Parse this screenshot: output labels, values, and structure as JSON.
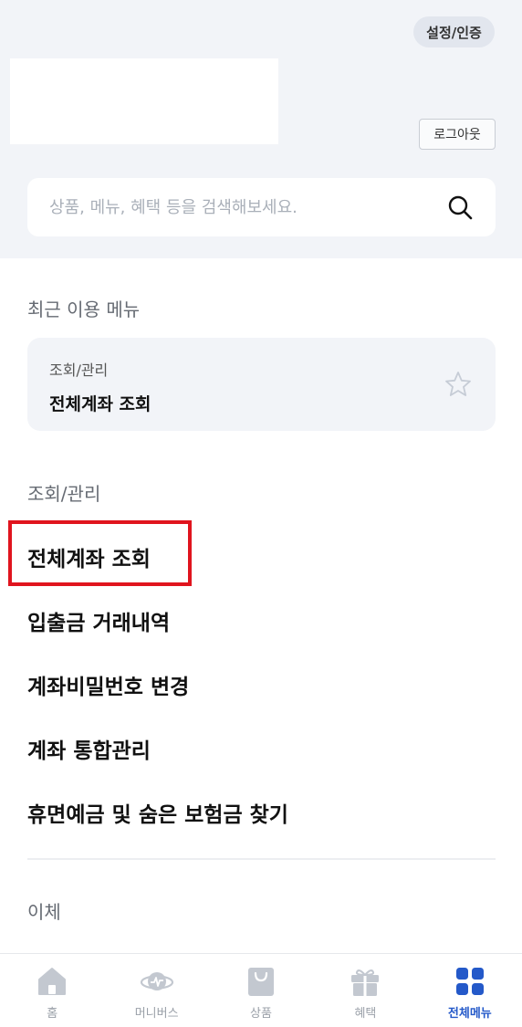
{
  "header": {
    "settings_label": "설정/인증",
    "logout_label": "로그아웃"
  },
  "search": {
    "placeholder": "상품, 메뉴, 혜택 등을 검색해보세요."
  },
  "recent": {
    "title": "최근 이용 메뉴",
    "card": {
      "category": "조회/관리",
      "name": "전체계좌 조회"
    }
  },
  "inquiry": {
    "title": "조회/관리",
    "items": [
      {
        "label": "전체계좌 조회",
        "highlighted": true
      },
      {
        "label": "입출금 거래내역"
      },
      {
        "label": "계좌비밀번호 변경"
      },
      {
        "label": "계좌 통합관리"
      },
      {
        "label": "휴면예금 및 숨은 보험금 찾기"
      }
    ]
  },
  "transfer": {
    "title": "이체"
  },
  "bottom_nav": {
    "items": [
      {
        "label": "홈",
        "icon": "home-icon"
      },
      {
        "label": "머니버스",
        "icon": "planet-icon"
      },
      {
        "label": "상품",
        "icon": "shopping-bag-icon"
      },
      {
        "label": "혜택",
        "icon": "gift-icon"
      },
      {
        "label": "전체메뉴",
        "icon": "grid-menu-icon",
        "active": true
      }
    ]
  },
  "colors": {
    "header_bg": "#f2f4f8",
    "highlight": "#e0141e",
    "active_nav": "#2459c9",
    "inactive_nav": "#c3c8d0"
  }
}
